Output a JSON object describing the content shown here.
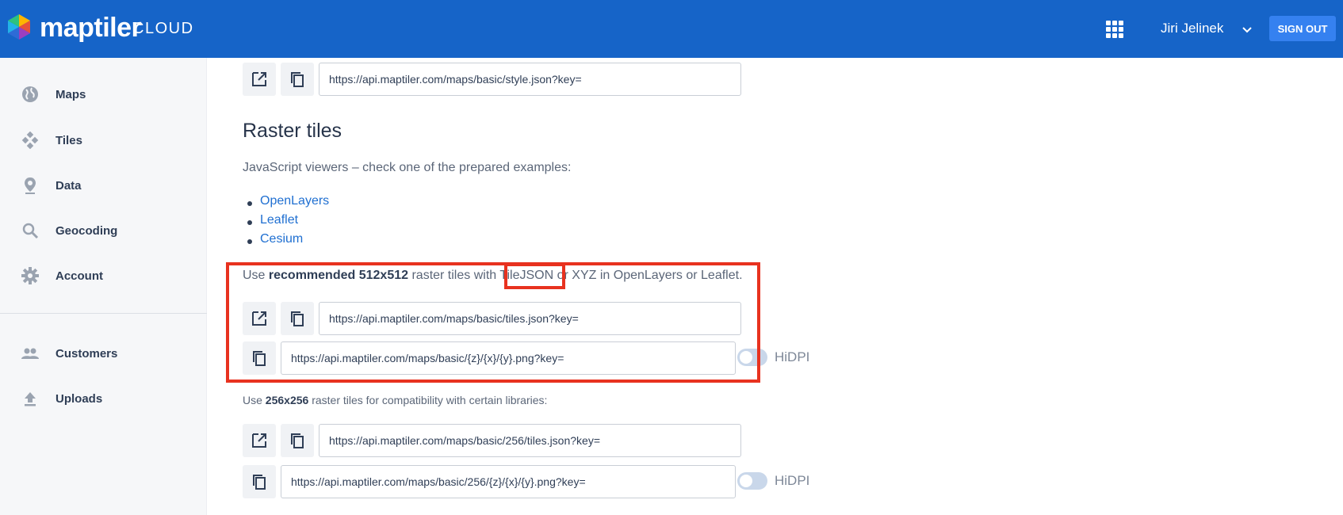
{
  "header": {
    "brand": "maptiler",
    "brand_tail": "CLOUD",
    "user_name": "Jiri Jelinek",
    "sign_out": "SIGN OUT"
  },
  "sidebar": {
    "items": [
      {
        "label": "Maps",
        "icon": "globe-icon"
      },
      {
        "label": "Tiles",
        "icon": "tiles-icon"
      },
      {
        "label": "Data",
        "icon": "pin-icon"
      },
      {
        "label": "Geocoding",
        "icon": "search-icon"
      },
      {
        "label": "Account",
        "icon": "gear-icon"
      },
      {
        "label": "Customers",
        "icon": "people-icon"
      },
      {
        "label": "Uploads",
        "icon": "upload-icon"
      }
    ]
  },
  "main": {
    "style_url": "https://api.maptiler.com/maps/basic/style.json?key=",
    "raster_title": "Raster tiles",
    "viewers_text": "JavaScript viewers – check one of the prepared examples:",
    "examples": [
      "OpenLayers",
      "Leaflet",
      "Cesium"
    ],
    "rec_prefix": "Use ",
    "rec_bold": "recommended 512x512",
    "rec_mid": " raster tiles with ",
    "rec_tilejson": "TileJSON",
    "rec_suffix": " or XYZ in OpenLayers or Leaflet.",
    "tiles_json_url": "https://api.maptiler.com/maps/basic/tiles.json?key=",
    "xyz_url": "https://api.maptiler.com/maps/basic/{z}/{x}/{y}.png?key=",
    "hidpi": "HiDPI",
    "compat_prefix": "Use ",
    "compat_bold": "256x256",
    "compat_suffix": " raster tiles for compatibility with certain libraries:",
    "tiles_json_256_url": "https://api.maptiler.com/maps/basic/256/tiles.json?key=",
    "xyz_256_url": "https://api.maptiler.com/maps/basic/256/{z}/{x}/{y}.png?key="
  },
  "colors": {
    "header_bg": "#1664c8",
    "highlight": "#e8321f",
    "link": "#1f6fd1"
  }
}
